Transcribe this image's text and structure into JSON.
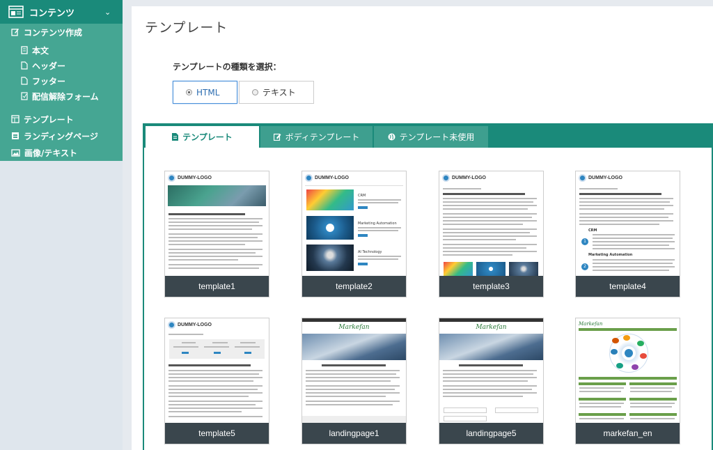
{
  "sidebar": {
    "header": "コンテンツ",
    "items": [
      {
        "label": "コンテンツ作成"
      },
      {
        "label": "本文"
      },
      {
        "label": "ヘッダー"
      },
      {
        "label": "フッター"
      },
      {
        "label": "配信解除フォーム"
      },
      {
        "label": "テンプレート"
      },
      {
        "label": "ランディングページ"
      },
      {
        "label": "画像/テキスト"
      }
    ]
  },
  "main": {
    "title": "テンプレート",
    "type_label": "テンプレートの種類を選択：",
    "radio": {
      "html": "HTML",
      "text": "テキスト",
      "selected": "HTML"
    },
    "tabs": [
      {
        "label": "テンプレート"
      },
      {
        "label": "ボディテンプレート"
      },
      {
        "label": "テンプレート未使用"
      }
    ],
    "cards": [
      {
        "name": "template1"
      },
      {
        "name": "template2"
      },
      {
        "name": "template3"
      },
      {
        "name": "template4"
      },
      {
        "name": "template5"
      },
      {
        "name": "landingpage1"
      },
      {
        "name": "landingpage5"
      },
      {
        "name": "markefan_en"
      }
    ],
    "thumb_text": {
      "logo": "DUMMY-LOGO",
      "crm": "CRM",
      "marketing_automation": "Marketing Automation",
      "ai_technology": "AI Technology",
      "markefan": "Markefan"
    }
  },
  "colors": {
    "accent": "#1a8a7a",
    "menu_bg": "#45a693",
    "caption_bg": "#3a464d",
    "tab_inactive": "#3e9f8f"
  }
}
